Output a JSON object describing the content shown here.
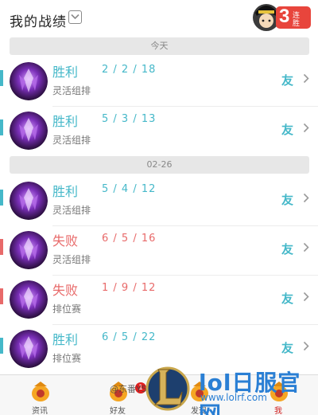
{
  "header": {
    "title": "我的战绩",
    "streak_number": "3",
    "streak_text": "连胜"
  },
  "sections": [
    {
      "date": "今天",
      "matches": [
        {
          "result": "胜利",
          "outcome": "win",
          "kda": "2 / 2 / 18",
          "mode": "灵活组排",
          "friend": "友"
        },
        {
          "result": "胜利",
          "outcome": "win",
          "kda": "5 / 3 / 13",
          "mode": "灵活组排",
          "friend": "友"
        }
      ]
    },
    {
      "date": "02-26",
      "matches": [
        {
          "result": "胜利",
          "outcome": "win",
          "kda": "5 / 4 / 12",
          "mode": "灵活组排",
          "friend": "友"
        },
        {
          "result": "失败",
          "outcome": "lose",
          "kda": "6 / 5 / 16",
          "mode": "灵活组排",
          "friend": "友"
        },
        {
          "result": "失败",
          "outcome": "lose",
          "kda": "1 / 9 / 12",
          "mode": "排位赛",
          "friend": "友"
        },
        {
          "result": "胜利",
          "outcome": "win",
          "kda": "6 / 5 / 22",
          "mode": "排位赛",
          "friend": "友"
        }
      ]
    }
  ],
  "tabbar": {
    "tabs": [
      {
        "label": "资讯",
        "icon": "news-icon",
        "active": false
      },
      {
        "label": "好友",
        "icon": "friends-icon",
        "active": false,
        "badge": "1"
      },
      {
        "label": "发现",
        "icon": "discover-icon",
        "active": false
      },
      {
        "label": "我",
        "icon": "me-icon",
        "active": true
      }
    ]
  },
  "watermark": {
    "weibo": "@东番Y5Candic",
    "site_name": "lol日服官网",
    "site_url": "www.lolrf.com"
  },
  "colors": {
    "win": "#45b8c9",
    "lose": "#e86a6a",
    "tab_active": "#d02020"
  }
}
